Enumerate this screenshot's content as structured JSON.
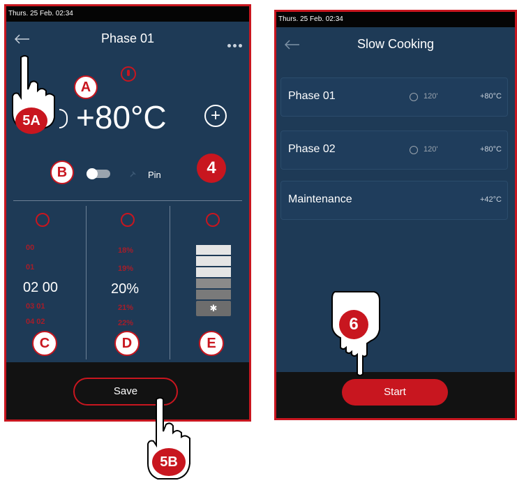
{
  "left_screen": {
    "status": "Thurs. 25 Feb. 02:34",
    "title": "Phase 01",
    "temperature": "+80°C",
    "plus": "+",
    "pin_label": "Pin",
    "time_col": {
      "above2": "00",
      "above1": "01",
      "main": "02 00",
      "below1": "03   01",
      "below2": "04   02"
    },
    "humidity_col": {
      "above2": "18%",
      "above1": "19%",
      "main": "20%",
      "below1": "21%",
      "below2": "22%"
    },
    "fan_levels_filled": 3,
    "save_label": "Save"
  },
  "right_screen": {
    "status": "Thurs. 25 Feb. 02:34",
    "title": "Slow Cooking",
    "phases": [
      {
        "name": "Phase 01",
        "time": "120'",
        "temp": "+80°C"
      },
      {
        "name": "Phase 02",
        "time": "120'",
        "temp": "+80°C"
      },
      {
        "name": "Maintenance",
        "time": "",
        "temp": "+42°C"
      }
    ],
    "start_label": "Start"
  },
  "annotations": {
    "A": "A",
    "B": "B",
    "C": "C",
    "D": "D",
    "E": "E",
    "step4": "4",
    "step5A": "5A",
    "step5B": "5B",
    "step6": "6"
  },
  "colors": {
    "accent": "#c8161f",
    "screen_bg": "#1e3a56",
    "bar_bg": "#121212"
  }
}
